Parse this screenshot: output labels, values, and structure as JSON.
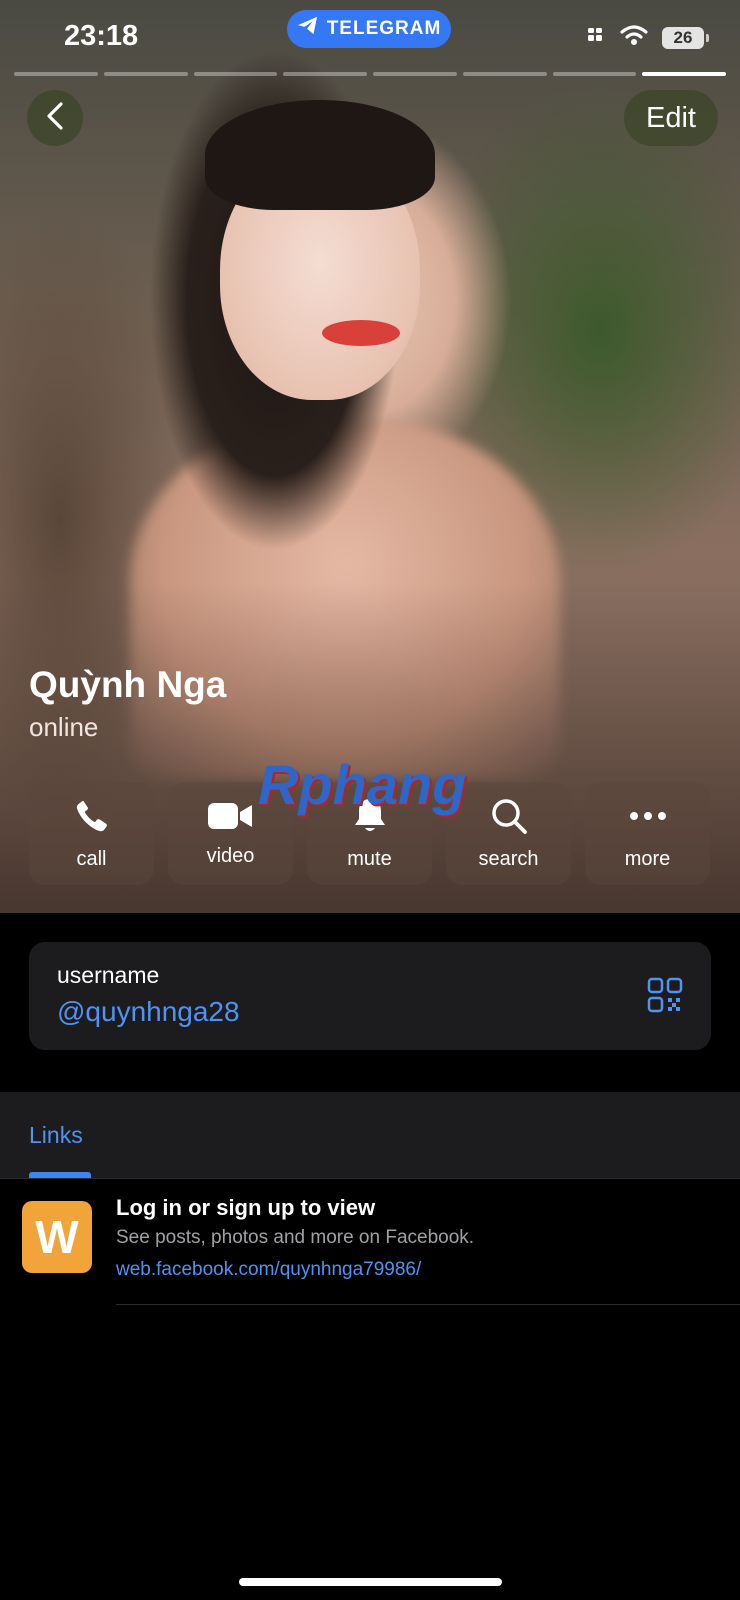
{
  "status_bar": {
    "time": "23:18",
    "pill_label": "TELEGRAM",
    "battery": "26"
  },
  "profile": {
    "name": "Quỳnh Nga",
    "status": "online"
  },
  "header": {
    "edit_label": "Edit"
  },
  "watermark": "Rphang",
  "actions": [
    {
      "label": "call",
      "icon": "phone-icon"
    },
    {
      "label": "video",
      "icon": "video-camera-icon"
    },
    {
      "label": "mute",
      "icon": "bell-icon"
    },
    {
      "label": "search",
      "icon": "search-icon"
    },
    {
      "label": "more",
      "icon": "more-dots-icon"
    }
  ],
  "username_card": {
    "label": "username",
    "value": "@quynhnga28",
    "icon": "qr-code-icon"
  },
  "tabs": {
    "links_label": "Links"
  },
  "link_item": {
    "icon_letter": "W",
    "title": "Log in or sign up to view",
    "description": "See posts, photos and more on Facebook.",
    "url": "web.facebook.com/quynhnga79986/"
  },
  "colors": {
    "accent": "#4f93f3",
    "telegram_pill": "#3478f6",
    "link_icon_bg": "#f0a43a"
  }
}
